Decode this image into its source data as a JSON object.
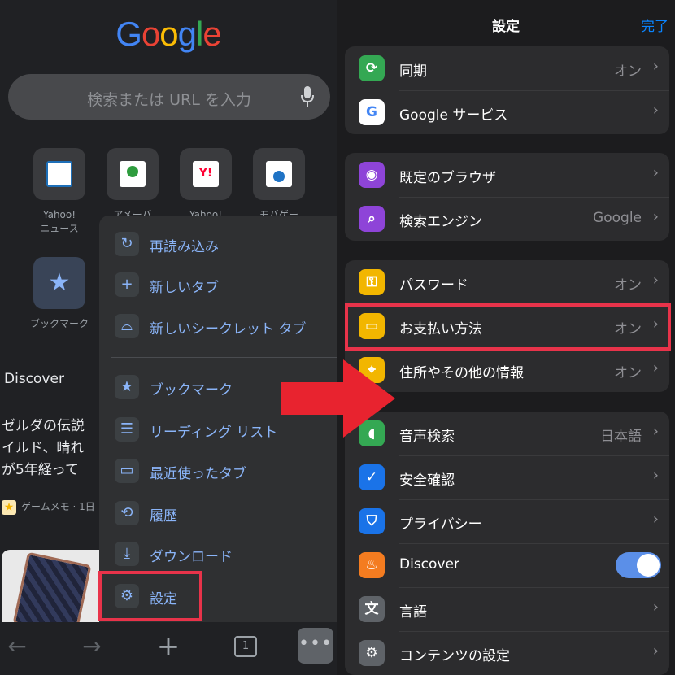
{
  "left": {
    "logo": "Google",
    "search_placeholder": "検索または URL を入力",
    "tiles": [
      {
        "label": "Yahoo!\nニュース",
        "icon": "yahoo-news-icon"
      },
      {
        "label": "アメーバ",
        "icon": "ameba-icon"
      },
      {
        "label": "Yahoo!",
        "icon": "yahoo-icon"
      },
      {
        "label": "モバゲー",
        "icon": "mobage-icon"
      },
      {
        "label": "ブックマーク",
        "icon": "star-icon"
      }
    ],
    "discover_title": "Discover",
    "article_text": "ゼルダの伝説\nイルド、晴れ\nが5年経って",
    "article_source": "ゲームメモ · 1日"
  },
  "menu": {
    "items": [
      {
        "label": "再読み込み",
        "icon": "reload-icon",
        "glyph": "↻"
      },
      {
        "label": "新しいタブ",
        "icon": "plus-icon",
        "glyph": "+"
      },
      {
        "label": "新しいシークレット タブ",
        "icon": "incognito-icon",
        "glyph": "⌓"
      },
      {
        "label": "ブックマーク",
        "icon": "star-icon",
        "glyph": "★"
      },
      {
        "label": "リーディング リスト",
        "icon": "reading-list-icon",
        "glyph": "☰"
      },
      {
        "label": "最近使ったタブ",
        "icon": "recent-tabs-icon",
        "glyph": "▭"
      },
      {
        "label": "履歴",
        "icon": "history-icon",
        "glyph": "⟲"
      },
      {
        "label": "ダウンロード",
        "icon": "download-icon",
        "glyph": "⤓"
      },
      {
        "label": "設定",
        "icon": "gear-icon",
        "glyph": "⚙"
      }
    ]
  },
  "toolbar": {
    "back": "←",
    "forward": "→",
    "new_tab": "+",
    "tab_count": "1",
    "more": "•••"
  },
  "right": {
    "title": "設定",
    "done": "完了",
    "groups": [
      [
        {
          "label": "同期",
          "value": "オン",
          "icon": "sync-icon",
          "glyph": "⟳",
          "color": "#34a853"
        },
        {
          "label": "Google サービス",
          "value": "",
          "icon": "google-icon",
          "glyph": "G",
          "color": "#ffffff"
        }
      ],
      [
        {
          "label": "既定のブラウザ",
          "value": "",
          "icon": "globe-icon",
          "glyph": "◉",
          "color": "#8e44d8"
        },
        {
          "label": "検索エンジン",
          "value": "Google",
          "icon": "search-icon",
          "glyph": "⌕",
          "color": "#8e44d8"
        }
      ],
      [
        {
          "label": "パスワード",
          "value": "オン",
          "icon": "key-icon",
          "glyph": "⚿",
          "color": "#f2b600"
        },
        {
          "label": "お支払い方法",
          "value": "オン",
          "icon": "credit-card-icon",
          "glyph": "▭",
          "color": "#f2b600"
        },
        {
          "label": "住所やその他の情報",
          "value": "オン",
          "icon": "location-pin-icon",
          "glyph": "⌖",
          "color": "#f2b600"
        }
      ],
      [
        {
          "label": "音声検索",
          "value": "日本語",
          "icon": "mic-icon",
          "glyph": "🎙",
          "color": "#34a853"
        },
        {
          "label": "安全確認",
          "value": "",
          "icon": "shield-check-icon",
          "glyph": "✓",
          "color": "#1a73e8"
        },
        {
          "label": "プライバシー",
          "value": "",
          "icon": "shield-icon",
          "glyph": "⛉",
          "color": "#1a73e8"
        },
        {
          "label": "Discover",
          "value": "",
          "icon": "flame-icon",
          "glyph": "♨",
          "color": "#f47c20",
          "toggle": true
        },
        {
          "label": "言語",
          "value": "",
          "icon": "translate-icon",
          "glyph": "文",
          "color": "#5f6368"
        },
        {
          "label": "コンテンツの設定",
          "value": "",
          "icon": "gear-icon",
          "glyph": "⚙",
          "color": "#5f6368"
        }
      ]
    ]
  },
  "colors": {
    "accent_blue": "#8ab4f8",
    "highlight_red": "#e8334a",
    "done_blue": "#0a84ff",
    "toggle_on": "#5b8fe8"
  }
}
